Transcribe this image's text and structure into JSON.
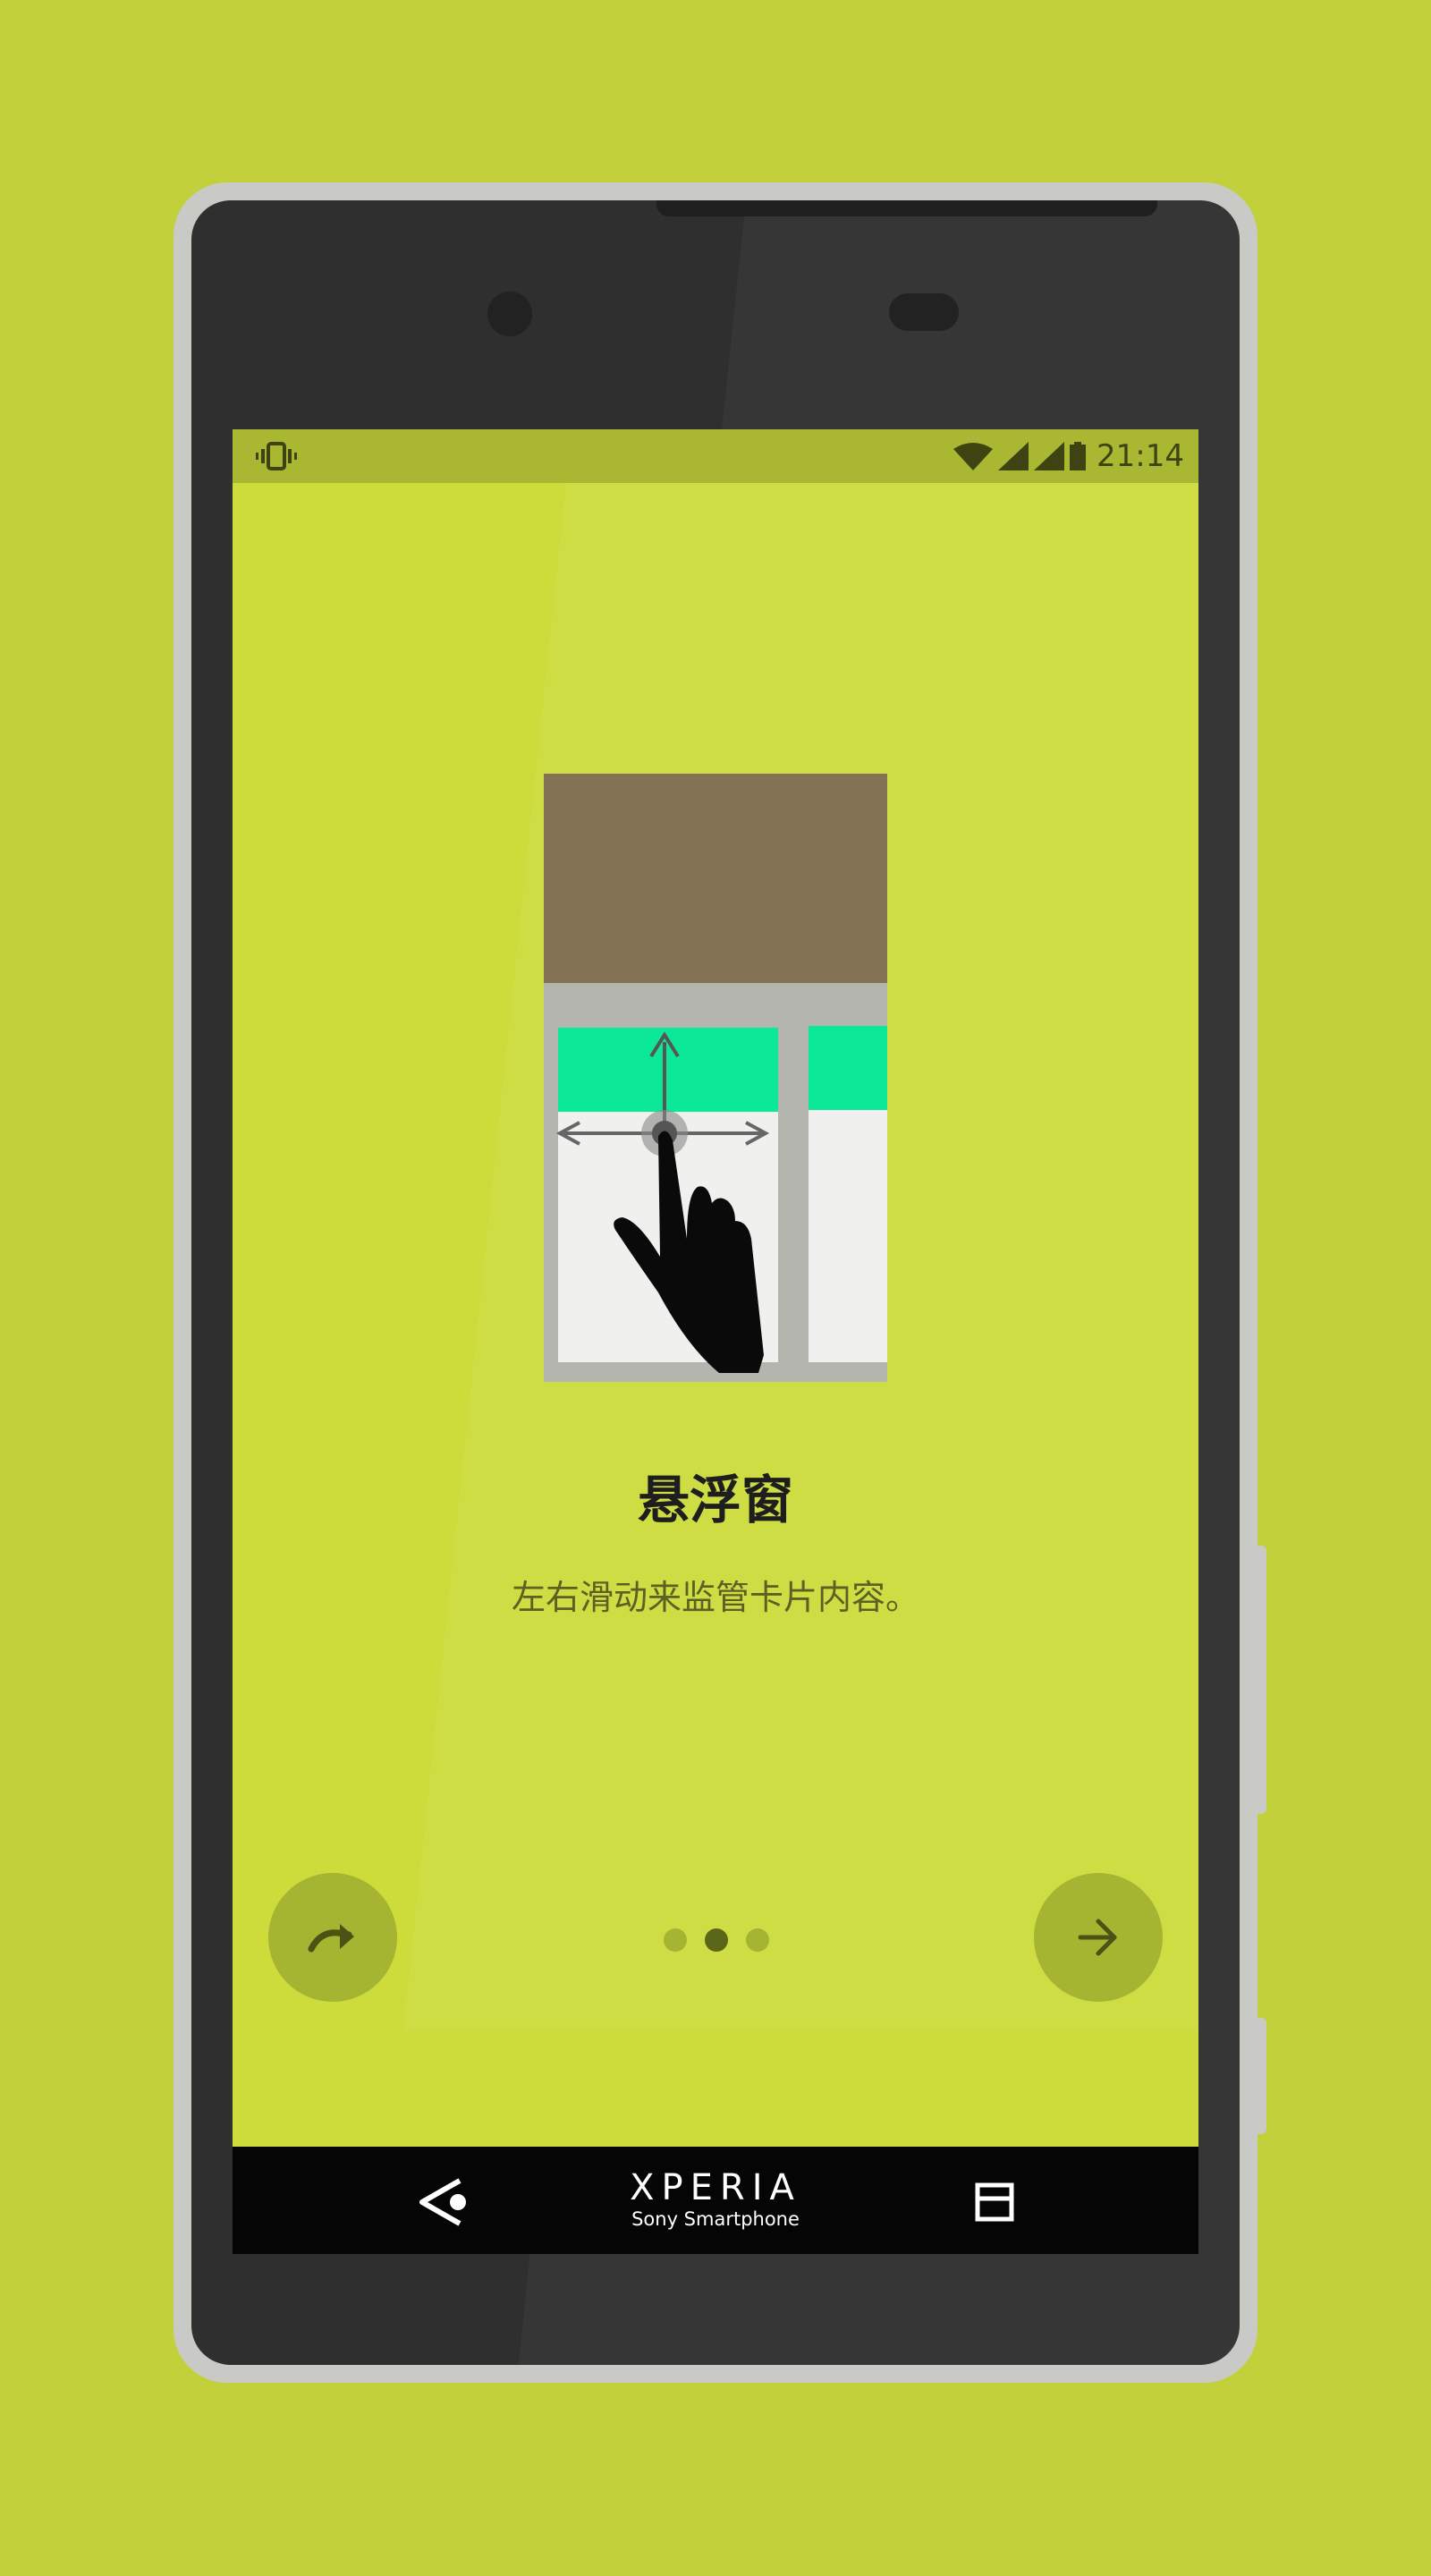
{
  "status_bar": {
    "time": "21:14",
    "icons": [
      "vibrate-icon",
      "wifi-icon",
      "signal-icon",
      "signal-icon",
      "battery-icon"
    ]
  },
  "onboarding": {
    "title": "悬浮窗",
    "description": "左右滑动来监管卡片内容。",
    "page_indicator": {
      "total": 3,
      "current": 2
    },
    "skip_icon": "skip-forward-icon",
    "next_icon": "arrow-right-icon"
  },
  "nav_bar": {
    "brand": "XPERIA",
    "brand_sub": "Sony Smartphone",
    "back_icon": "back-triangle-icon",
    "recent_icon": "recent-apps-icon"
  },
  "colors": {
    "background": "#c2d13b",
    "screen": "#cddc3b",
    "status_bar": "#a9b733",
    "accent_green": "#0be897",
    "card_brown": "#837253"
  }
}
